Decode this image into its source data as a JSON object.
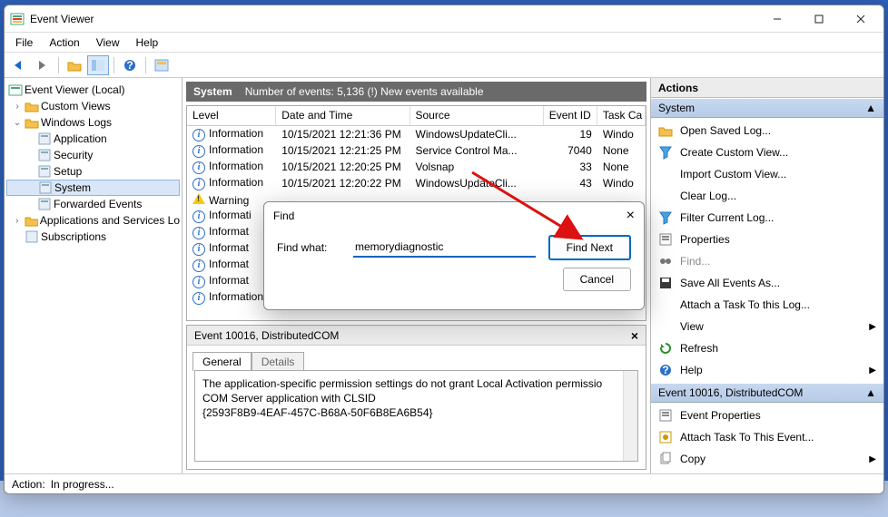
{
  "window": {
    "title": "Event Viewer",
    "menus": [
      "File",
      "Action",
      "View",
      "Help"
    ]
  },
  "tree": {
    "root": "Event Viewer (Local)",
    "custom_views": "Custom Views",
    "windows_logs": "Windows Logs",
    "wl_children": [
      "Application",
      "Security",
      "Setup",
      "System",
      "Forwarded Events"
    ],
    "apps_services": "Applications and Services Lo",
    "subscriptions": "Subscriptions"
  },
  "grid": {
    "title": "System",
    "count_label": "Number of events: 5,136 (!) New events available",
    "cols": [
      "Level",
      "Date and Time",
      "Source",
      "Event ID",
      "Task Ca"
    ],
    "rows": [
      {
        "level": "Information",
        "icon": "info",
        "dt": "10/15/2021 12:21:36 PM",
        "src": "WindowsUpdateCli...",
        "eid": "19",
        "tc": "Windo"
      },
      {
        "level": "Information",
        "icon": "info",
        "dt": "10/15/2021 12:21:25 PM",
        "src": "Service Control Ma...",
        "eid": "7040",
        "tc": "None"
      },
      {
        "level": "Information",
        "icon": "info",
        "dt": "10/15/2021 12:20:25 PM",
        "src": "Volsnap",
        "eid": "33",
        "tc": "None"
      },
      {
        "level": "Information",
        "icon": "info",
        "dt": "10/15/2021 12:20:22 PM",
        "src": "WindowsUpdateCli...",
        "eid": "43",
        "tc": "Windo"
      },
      {
        "level": "Warning",
        "icon": "warn",
        "dt": "",
        "src": "",
        "eid": "",
        "tc": ""
      },
      {
        "level": "Informati",
        "icon": "info",
        "dt": "",
        "src": "",
        "eid": "",
        "tc": ""
      },
      {
        "level": "Informat",
        "icon": "info",
        "dt": "",
        "src": "",
        "eid": "",
        "tc": ""
      },
      {
        "level": "Informat",
        "icon": "info",
        "dt": "",
        "src": "",
        "eid": "",
        "tc": ""
      },
      {
        "level": "Informat",
        "icon": "info",
        "dt": "",
        "src": "",
        "eid": "",
        "tc": ""
      },
      {
        "level": "Informat",
        "icon": "info",
        "dt": "",
        "src": "",
        "eid": "",
        "tc": ""
      },
      {
        "level": "Information",
        "icon": "info",
        "dt": "",
        "src": "",
        "eid": "",
        "tc": ""
      }
    ]
  },
  "detail": {
    "title": "Event 10016, DistributedCOM",
    "tabs": [
      "General",
      "Details"
    ],
    "body_line1": "The application-specific permission settings do not grant Local Activation permissio",
    "body_line2": "COM Server application with CLSID",
    "body_line3": "{2593F8B9-4EAF-457C-B68A-50F6B8EA6B54}"
  },
  "actions": {
    "header": "Actions",
    "section1": "System",
    "list1": [
      {
        "icon": "folder-open",
        "label": "Open Saved Log..."
      },
      {
        "icon": "funnel",
        "label": "Create Custom View..."
      },
      {
        "icon": "blank",
        "label": "Import Custom View..."
      },
      {
        "icon": "blank",
        "label": "Clear Log..."
      },
      {
        "icon": "funnel",
        "label": "Filter Current Log..."
      },
      {
        "icon": "props",
        "label": "Properties"
      },
      {
        "icon": "binoc",
        "label": "Find...",
        "muted": true
      },
      {
        "icon": "save",
        "label": "Save All Events As..."
      },
      {
        "icon": "blank",
        "label": "Attach a Task To this Log..."
      },
      {
        "icon": "blank",
        "label": "View",
        "chev": true
      },
      {
        "icon": "refresh",
        "label": "Refresh"
      },
      {
        "icon": "help",
        "label": "Help",
        "chev": true
      }
    ],
    "section2": "Event 10016, DistributedCOM",
    "list2": [
      {
        "icon": "props",
        "label": "Event Properties"
      },
      {
        "icon": "task",
        "label": "Attach Task To This Event..."
      },
      {
        "icon": "copy",
        "label": "Copy",
        "chev": true
      }
    ]
  },
  "find": {
    "title": "Find",
    "label": "Find what:",
    "value": "memorydiagnostic",
    "find_next": "Find Next",
    "cancel": "Cancel"
  },
  "status": {
    "label": "Action:",
    "value": "In progress..."
  }
}
